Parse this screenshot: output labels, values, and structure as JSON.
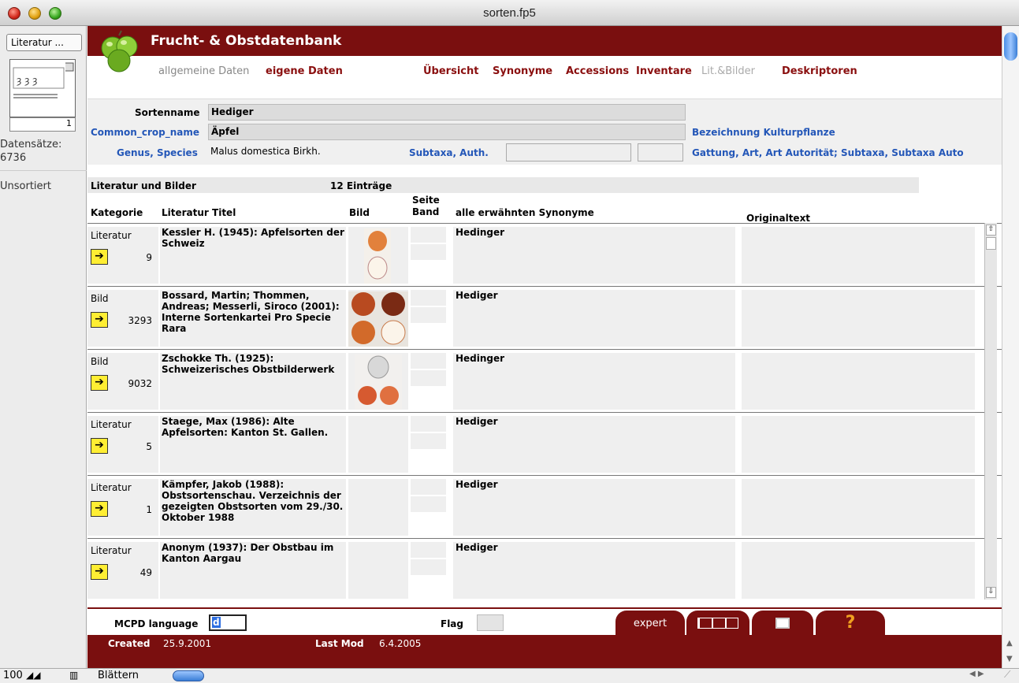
{
  "window": {
    "title": "sorten.fp5"
  },
  "status": {
    "layout_label": "Literatur ...",
    "record_number": "1",
    "records_label": "Datensätze:",
    "records_count": "6736",
    "sort_state": "Unsortiert"
  },
  "header": {
    "app_title": "Frucht- & Obstdatenbank"
  },
  "nav": {
    "general": "allgemeine Daten",
    "own": "eigene Daten",
    "overview": "Übersicht",
    "synonyms": "Synonyme",
    "accessions": "Accessions",
    "inventory": "Inventare",
    "lit_images": "Lit.&Bilder",
    "descriptors": "Deskriptoren"
  },
  "fields": {
    "sortenname_label": "Sortenname",
    "sortenname_value": "Hediger",
    "common_crop_label": "Common_crop_name",
    "common_crop_value": "Äpfel",
    "genus_label": "Genus, Species",
    "genus_value": "Malus domestica Birkh.",
    "subtaxa_label": "Subtaxa, Auth.",
    "bezeichnung_label": "Bezeichnung Kulturpflanze",
    "gattung_label": "Gattung, Art, Art Autorität; Subtaxa, Subtaxa Auto"
  },
  "list": {
    "title": "Literatur und Bilder",
    "count": "12 Einträge",
    "columns": {
      "kategorie": "Kategorie",
      "titel": "Literatur Titel",
      "bild": "Bild",
      "seite": "Seite",
      "band": "Band",
      "synonyme": "alle erwähnten Synonyme",
      "original": "Originaltext"
    },
    "rows": [
      {
        "kategorie": "Literatur",
        "id": "9",
        "titel": "Kessler H. (1945): Apfelsorten der Schweiz",
        "synonym": "Hedinger"
      },
      {
        "kategorie": "Bild",
        "id": "3293",
        "titel": "Bossard, Martin; Thommen, Andreas; Messerli, Siroco (2001): Interne Sortenkartei Pro Specie Rara",
        "synonym": "Hediger"
      },
      {
        "kategorie": "Bild",
        "id": "9032",
        "titel": "Zschokke Th. (1925): Schweizerisches Obstbilderwerk",
        "synonym": "Hedinger"
      },
      {
        "kategorie": "Literatur",
        "id": "5",
        "titel": "Staege, Max (1986): Alte Apfelsorten: Kanton St. Gallen.",
        "synonym": "Hediger"
      },
      {
        "kategorie": "Literatur",
        "id": "1",
        "titel": "Kämpfer, Jakob (1988): Obstsortenschau. Verzeichnis der gezeigten Obstsorten vom 29./30. Oktober 1988",
        "synonym": "Hediger"
      },
      {
        "kategorie": "Literatur",
        "id": "49",
        "titel": "Anonym (1937): Der Obstbau im Kanton Aargau",
        "synonym": "Hediger"
      }
    ]
  },
  "footer": {
    "mcpd_label": "MCPD language",
    "mcpd_value": "d",
    "flag_label": "Flag",
    "created_label": "Created",
    "created_value": "25.9.2001",
    "lastmod_label": "Last Mod",
    "lastmod_value": "6.4.2005",
    "tab_expert": "expert",
    "tab_help": "?"
  },
  "bottom": {
    "zoom": "100",
    "mode": "Blättern"
  },
  "colors": {
    "brand": "#7a0f0f",
    "link_blue": "#2457b8",
    "arrow_button": "#ffee33"
  }
}
